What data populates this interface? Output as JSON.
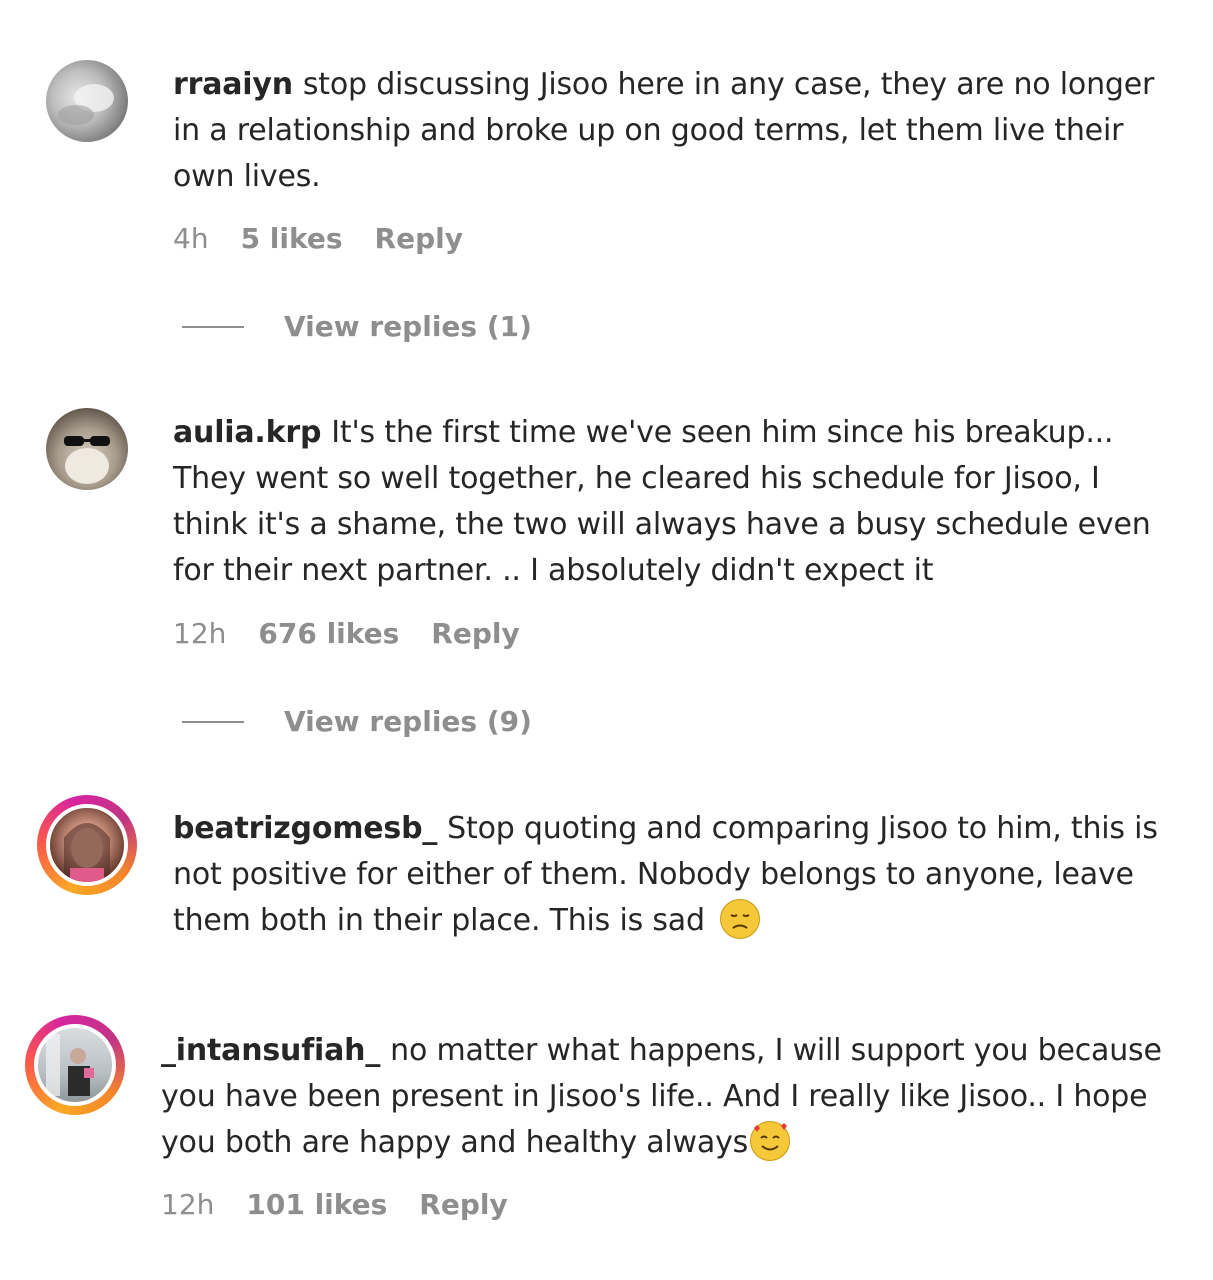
{
  "comments": [
    {
      "username": "rraaiyn",
      "text": "stop discussing Jisoo here in any case, they are no longer in a relationship and broke up on good terms, let them live their own lives.",
      "time": "4h",
      "likes": "5 likes",
      "reply": "Reply",
      "view_replies": "View replies (1)"
    },
    {
      "username": "aulia.krp",
      "text": "It's the first time we've seen him since his breakup... They went so well together, he cleared his schedule for Jisoo, I think it's a shame, the two will always have a busy schedule even for their next partner. .. I absolutely didn't expect it",
      "time": "12h",
      "likes": "676 likes",
      "reply": "Reply",
      "view_replies": "View replies (9)"
    },
    {
      "username": "beatrizgomesb_",
      "text": "Stop quoting and comparing Jisoo to him, this is not positive for either of them. Nobody belongs to anyone, leave them both in their place. This is sad",
      "emoji": "sad-face-emoji"
    },
    {
      "username": "_intansufiah_",
      "text": "no matter what happens, I will support you because you have been present in Jisoo's life.. And I really like Jisoo.. I hope you both are happy and healthy always",
      "emoji": "smiling-face-with-hearts-emoji",
      "time": "12h",
      "likes": "101 likes",
      "reply": "Reply"
    }
  ],
  "colors": {
    "text": "#262626",
    "secondary": "#8e8e8e",
    "story_ring_start": "#f9a825",
    "story_ring_end": "#d6249f"
  }
}
